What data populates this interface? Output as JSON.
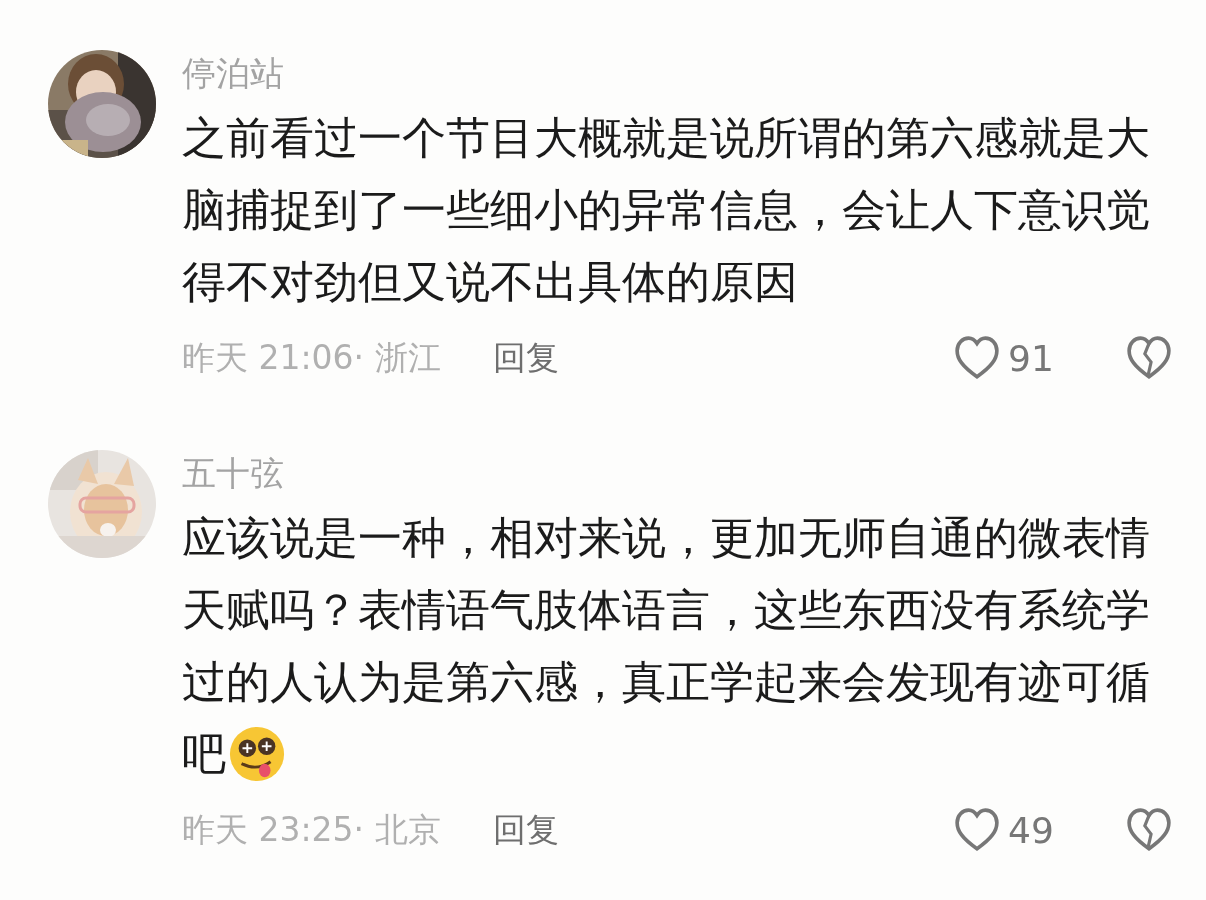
{
  "comments": [
    {
      "username": "停泊站",
      "avatar": {
        "kind": "picture"
      },
      "text_lines": [
        "之前看过一个节目大概就是说所谓的第六感就是大",
        "脑捕捉到了一些细小的异常信息，会让人下意识觉",
        "得不对劲但又说不出具体的原因"
      ],
      "trailing_emoji": false,
      "meta": "昨天 21:06· 浙江",
      "reply": "回复",
      "likes": "91",
      "liked": false,
      "disliked": false
    },
    {
      "username": "五十弦",
      "avatar": {
        "kind": "picture"
      },
      "text_lines": [
        "应该说是一种，相对来说，更加无师自通的微表情",
        "天赋吗？表情语气肢体语言，这些东西没有系统学",
        "过的人认为是第六感，真正学起来会发现有迹可循",
        "吧"
      ],
      "trailing_emoji": true,
      "meta": "昨天 23:25· 北京",
      "reply": "回复",
      "likes": "49",
      "liked": false,
      "disliked": false
    }
  ]
}
